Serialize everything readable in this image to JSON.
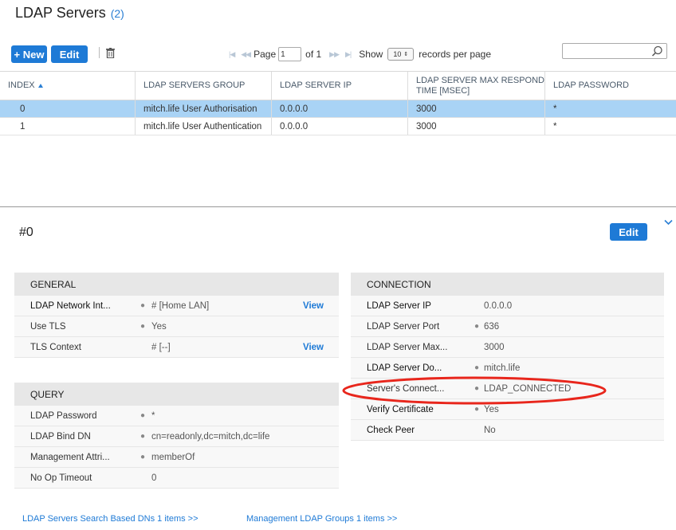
{
  "header": {
    "title": "LDAP Servers",
    "count": "(2)"
  },
  "toolbar": {
    "new_label": "+ New",
    "edit_label": "Edit"
  },
  "pager": {
    "page_label": "Page",
    "page_value": "1",
    "of_label": "of 1",
    "show_label": "Show",
    "page_size": "10",
    "records_label": "records per page"
  },
  "grid": {
    "columns": [
      "INDEX",
      "LDAP SERVERS GROUP",
      "LDAP SERVER IP",
      "LDAP SERVER MAX RESPOND TIME [MSEC]",
      "LDAP PASSWORD"
    ],
    "rows": [
      [
        "0",
        "mitch.life User Authorisation",
        "0.0.0.0",
        "3000",
        "*"
      ],
      [
        "1",
        "mitch.life User Authentication",
        "0.0.0.0",
        "3000",
        "*"
      ]
    ]
  },
  "detail": {
    "title": "#0",
    "edit_label": "Edit",
    "general": {
      "title": "GENERAL",
      "rows": [
        {
          "label": "LDAP Network Int...",
          "value": "# [Home LAN]",
          "link": "View"
        },
        {
          "label": "Use TLS",
          "value": "Yes"
        },
        {
          "label": "TLS Context",
          "value": "# [--]",
          "link": "View"
        }
      ]
    },
    "query": {
      "title": "QUERY",
      "rows": [
        {
          "label": "LDAP Password",
          "value": "*"
        },
        {
          "label": "LDAP Bind DN",
          "value": "cn=readonly,dc=mitch,dc=life"
        },
        {
          "label": "Management Attri...",
          "value": "memberOf"
        },
        {
          "label": "No Op Timeout",
          "value": "0"
        }
      ]
    },
    "connection": {
      "title": "CONNECTION",
      "rows": [
        {
          "label": "LDAP Server IP",
          "value": "0.0.0.0"
        },
        {
          "label": "LDAP Server Port",
          "value": "636"
        },
        {
          "label": "LDAP Server Max...",
          "value": "3000"
        },
        {
          "label": "LDAP Server Do...",
          "value": "mitch.life"
        },
        {
          "label": "Server's Connect...",
          "value": "LDAP_CONNECTED"
        },
        {
          "label": "Verify Certificate",
          "value": "Yes"
        },
        {
          "label": "Check Peer",
          "value": "No"
        }
      ]
    }
  },
  "footer": {
    "link1": "LDAP Servers Search Based DNs 1 items  >>",
    "link2": "Management LDAP Groups 1 items  >>"
  },
  "colors": {
    "accent": "#1e7ad6",
    "selected_row": "#a9d3f5",
    "annotation": "#e8261c"
  }
}
